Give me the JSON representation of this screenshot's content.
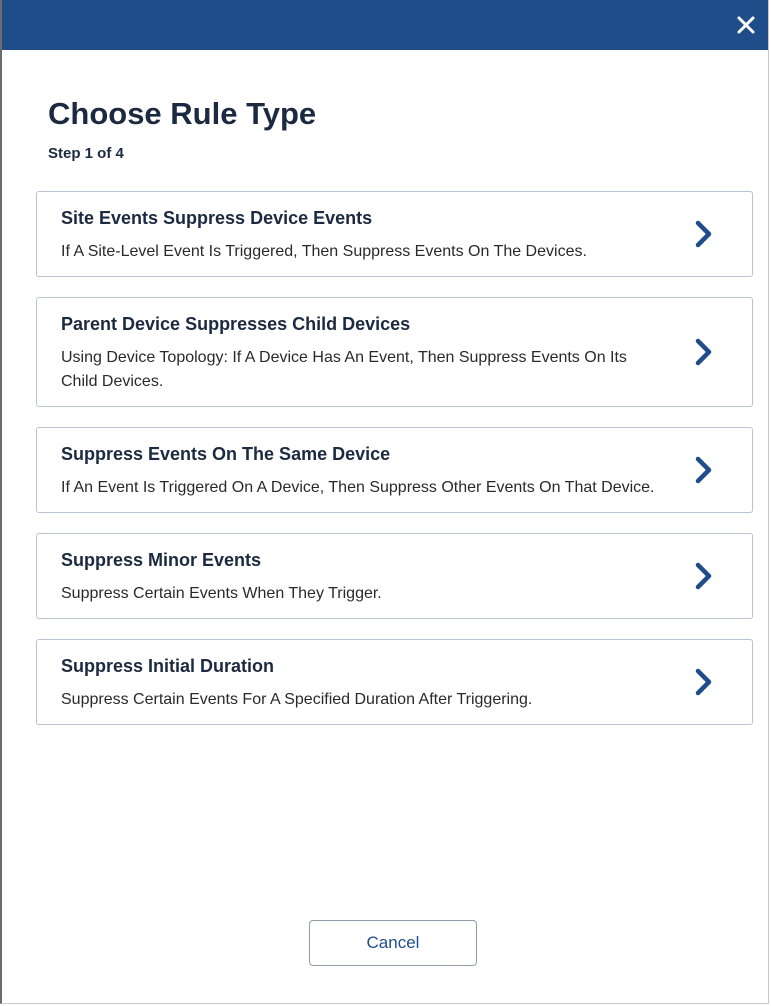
{
  "dialog": {
    "title": "Choose Rule Type",
    "step": "Step 1 of 4",
    "close_icon": "close-icon",
    "options": [
      {
        "title": "Site Events Suppress Device Events",
        "description": "If A Site-Level Event Is Triggered, Then Suppress Events On The Devices.",
        "icon": "chevron-right-icon"
      },
      {
        "title": "Parent Device Suppresses Child Devices",
        "description": "Using Device Topology: If A Device Has An Event, Then Suppress Events On Its Child Devices.",
        "icon": "chevron-right-icon"
      },
      {
        "title": "Suppress Events On The Same Device",
        "description": "If An Event Is Triggered On A Device, Then Suppress Other Events On That Device.",
        "icon": "chevron-right-icon"
      },
      {
        "title": "Suppress Minor Events",
        "description": "Suppress Certain Events When They Trigger.",
        "icon": "chevron-right-icon"
      },
      {
        "title": "Suppress Initial Duration",
        "description": "Suppress Certain Events For A Specified Duration After Triggering.",
        "icon": "chevron-right-icon"
      }
    ],
    "cancel_label": "Cancel"
  },
  "colors": {
    "header": "#1f4d8a",
    "title_text": "#1b2a40",
    "chevron": "#1f4d8a",
    "card_border": "#b9c4d2"
  }
}
